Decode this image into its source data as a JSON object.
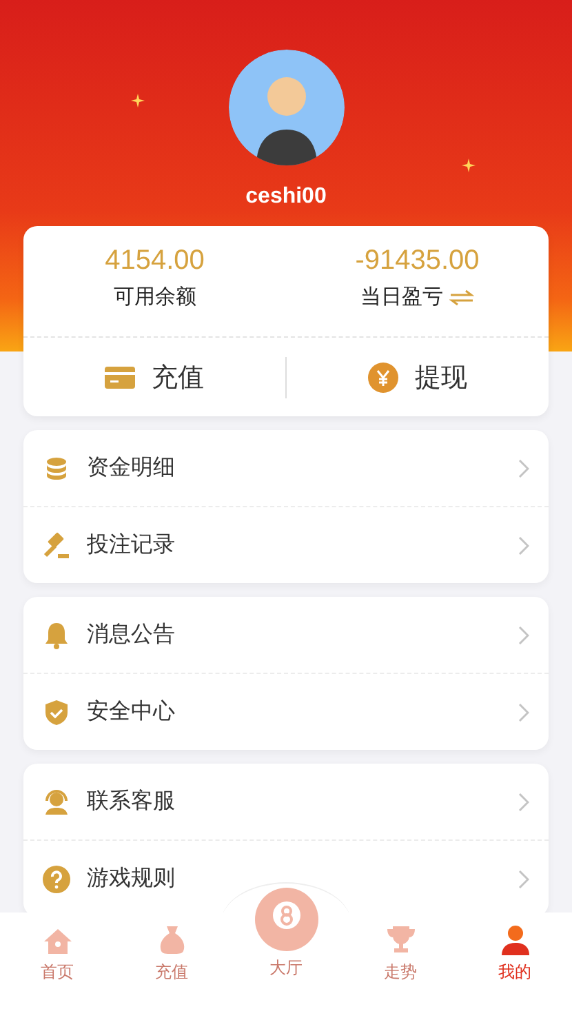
{
  "profile": {
    "username": "ceshi00"
  },
  "stats": [
    {
      "value": "4154.00",
      "label": "可用余额",
      "swap": false
    },
    {
      "value": "-91435.00",
      "label": "当日盈亏",
      "swap": true
    }
  ],
  "actions": [
    {
      "kind": "card",
      "label": "充值"
    },
    {
      "kind": "yen",
      "label": "提现"
    }
  ],
  "menu_groups": [
    [
      {
        "kind": "coins",
        "label": "资金明细"
      },
      {
        "kind": "gavel",
        "label": "投注记录"
      }
    ],
    [
      {
        "kind": "bell",
        "label": "消息公告"
      },
      {
        "kind": "shield",
        "label": "安全中心"
      }
    ],
    [
      {
        "kind": "headset",
        "label": "联系客服"
      },
      {
        "kind": "help",
        "label": "游戏规则"
      }
    ]
  ],
  "nav": [
    {
      "kind": "home",
      "label": "首页",
      "selected": false
    },
    {
      "kind": "bag",
      "label": "充值",
      "selected": false
    },
    {
      "kind": "ball",
      "label": "大厅",
      "selected": false
    },
    {
      "kind": "trophy",
      "label": "走势",
      "selected": false
    },
    {
      "kind": "user",
      "label": "我的",
      "selected": true
    }
  ]
}
